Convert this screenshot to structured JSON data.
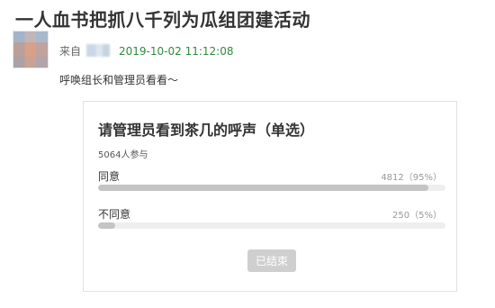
{
  "post": {
    "title": "一人血书把抓八千列为瓜组团建活动",
    "from_label": "来自",
    "timestamp": "2019-10-02 11:12:08",
    "body": "呼唤组长和管理员看看～"
  },
  "poll": {
    "title": "请管理员看到茶几的呼声（单选）",
    "participants": "5064人参与",
    "options": [
      {
        "label": "同意",
        "stat": "4812（95%）",
        "fraction": 0.95
      },
      {
        "label": "不同意",
        "stat": "250（5%）",
        "fraction": 0.05
      }
    ],
    "button_label": "已结束"
  },
  "colors": {
    "timestamp": "#2e8b3b",
    "bar_fill": "#c4c4c4",
    "bar_track": "#eeeeee",
    "button_bg": "#cfcfcf"
  }
}
